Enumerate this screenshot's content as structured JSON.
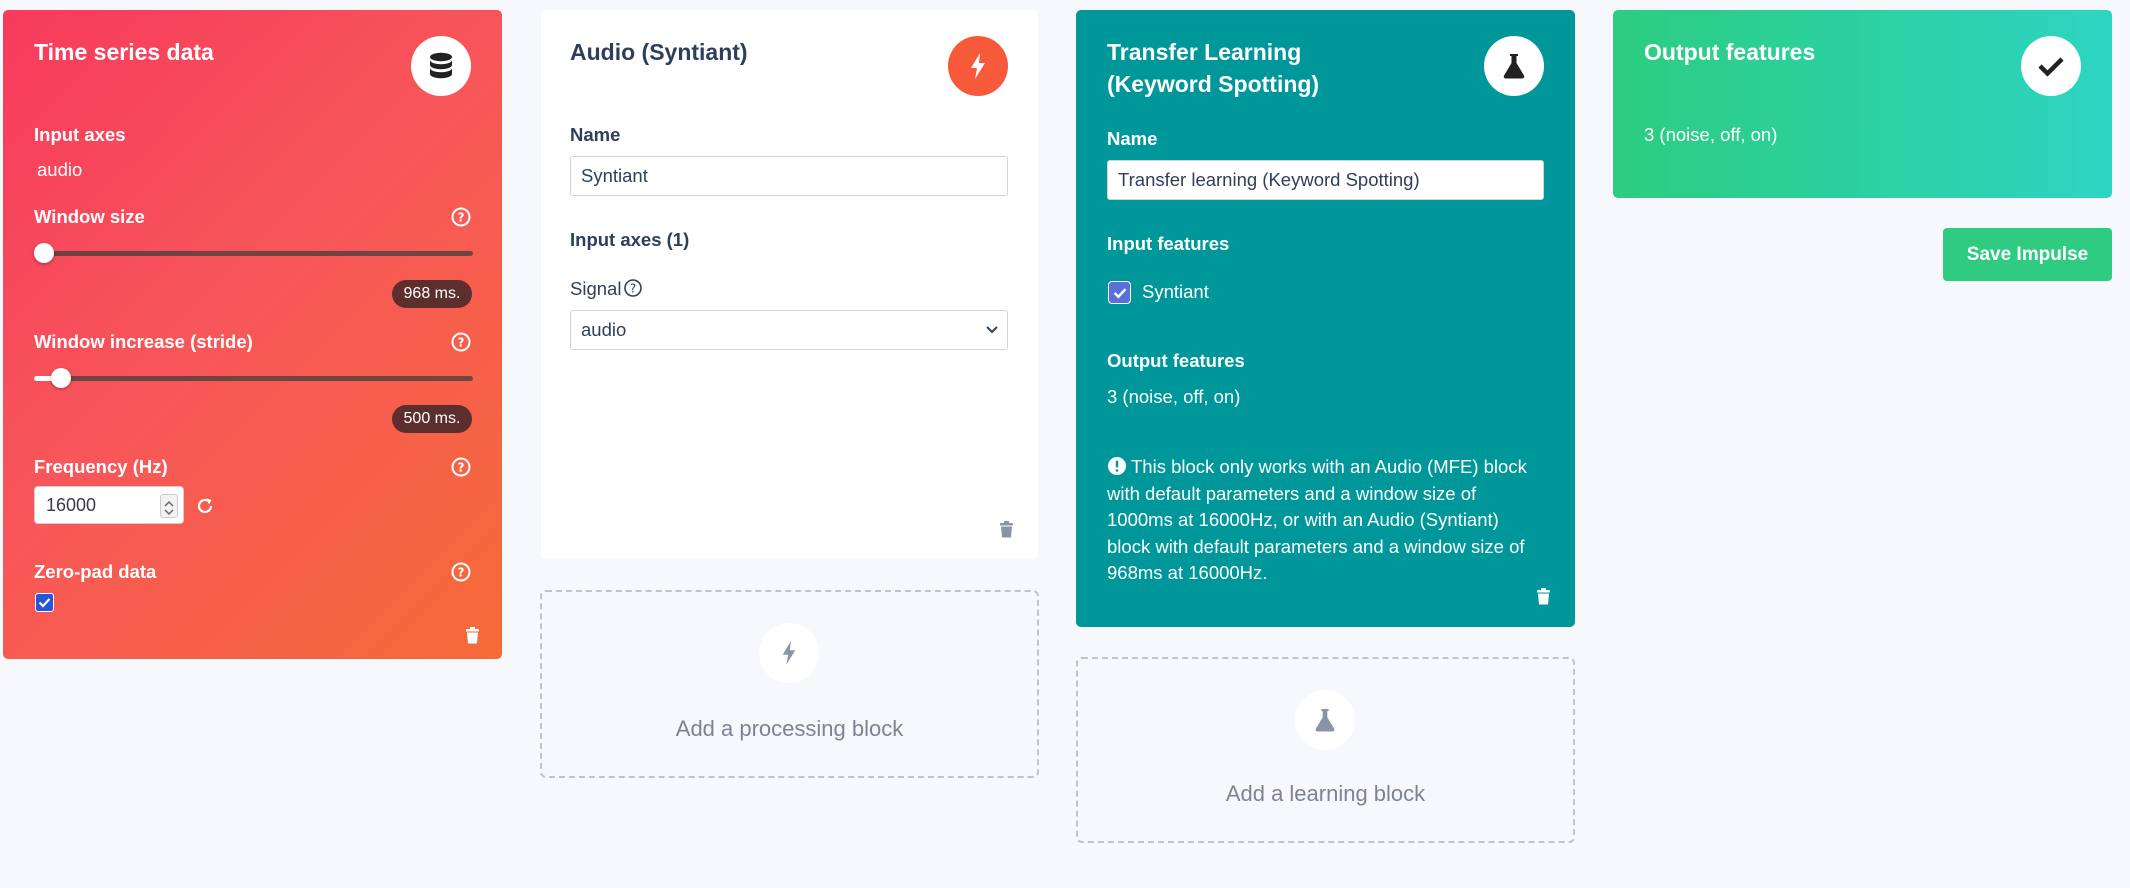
{
  "time_series": {
    "title": "Time series data",
    "input_axes_label": "Input axes",
    "input_axes_value": "audio",
    "window_size_label": "Window size",
    "window_size_value": "968 ms.",
    "window_size_fraction": 0.0,
    "window_increase_label": "Window increase (stride)",
    "window_increase_value": "500 ms.",
    "window_increase_fraction": 0.04,
    "frequency_label": "Frequency (Hz)",
    "frequency_value": "16000",
    "zero_pad_label": "Zero-pad data",
    "zero_pad_checked": true,
    "icon": "database-icon"
  },
  "processing": {
    "title": "Audio (Syntiant)",
    "name_label": "Name",
    "name_value": "Syntiant",
    "input_axes_label": "Input axes (1)",
    "signal_label": "Signal",
    "signal_selected": "audio",
    "icon": "bolt-icon",
    "add_label": "Add a processing block"
  },
  "learning": {
    "title": "Transfer Learning (Keyword Spotting)",
    "name_label": "Name",
    "name_value": "Transfer learning (Keyword Spotting)",
    "input_features_label": "Input features",
    "input_feature_item": "Syntiant",
    "output_features_label": "Output features",
    "output_features_value": "3 (noise, off, on)",
    "warning": "This block only works with an Audio (MFE) block with default parameters and a window size of 1000ms at 16000Hz, or with an Audio (Syntiant) block with default parameters and a window size of 968ms at 16000Hz.",
    "icon": "flask-icon",
    "add_label": "Add a learning block"
  },
  "output": {
    "title": "Output features",
    "value": "3 (noise, off, on)",
    "icon": "check-icon"
  },
  "save_label": "Save Impulse",
  "colors": {
    "time_series_start": "#f73a5d",
    "time_series_end": "#f66b37",
    "processing_accent": "#f7593b",
    "learning_bg": "#00979a",
    "output_start": "#2ccd80",
    "output_end": "#2dd4c2",
    "save_button": "#2ecb80"
  }
}
